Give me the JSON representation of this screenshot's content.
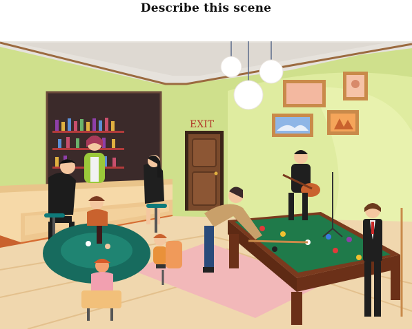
{
  "prompt": "Describe this scene",
  "scene": {
    "exit_sign": "EXIT",
    "colors": {
      "wall": "#cfe08c",
      "wall_light": "#e3ee9f",
      "ceiling": "#e6e2dc",
      "floor": "#f0d7ae",
      "rug": "#f2b8b9",
      "pool_table_felt": "#1f7a4a",
      "poker_table_felt": "#176b5e",
      "bar_counter": "#f6d9a8",
      "wood": "#8a4a2a",
      "exit_text": "#b33a2a"
    }
  }
}
